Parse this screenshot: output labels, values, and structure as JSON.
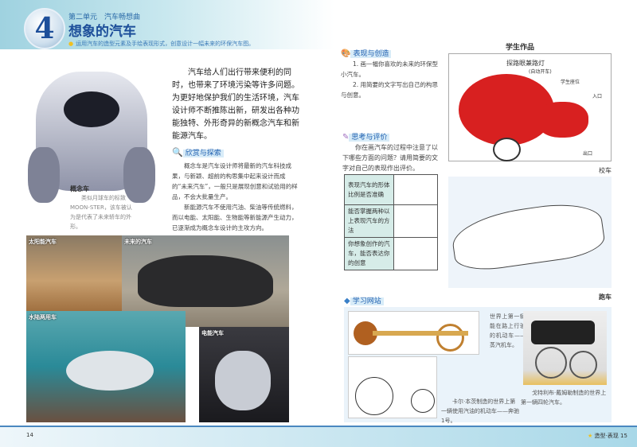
{
  "header": {
    "lesson_number": "4",
    "unit": "第二单元　汽车畅想曲",
    "title": "想象的汽车",
    "goal": "运用汽车的造型元素及手绘表现形式，创意设计一幅未来的环保汽车图。"
  },
  "intro": "汽车给人们出行带来便利的同时，也带来了环境污染等许多问题。为更好地保护我们的生活环境，汽车设计师不断推陈出新，研发出各种功能独特、外形奇异的新概念汽车和新能源汽车。",
  "explore": {
    "heading": "欣赏与探索",
    "p1": "概念车是汽车设计师将最新的汽车科技成果，与新颖、超前的构思集中起来设计而成的“未来汽车”，一般只是展现创意和试验用的样品，不会大批量生产。",
    "p2": "新能源汽车不使用汽油、柴油等传统燃料，而以电能、太阳能、生物能等新能源产生动力，已逐渐成为概念车设计的主攻方向。"
  },
  "concept": {
    "title": "概念车",
    "text": "类似月球车的标致MOON-STER，该车被认为是代表了未来轿车的外形。"
  },
  "photos": [
    "太阳能汽车",
    "未来的汽车",
    "水陆两用车",
    "电能汽车"
  ],
  "create": {
    "heading": "表现与创造",
    "items": [
      "1. 画一幅你喜欢的未来的环保型小汽车。",
      "2. 用简要的文字写出自己的构思与创意。"
    ]
  },
  "evaluate": {
    "heading": "思考与评价",
    "text": "你在画汽车的过程中注意了以下哪些方面的问题？请用简要的文字对自己的表现作出评价。",
    "rows": [
      "表现汽车的形体比例是否准确",
      "能否掌握两种以上表现汽车的方法",
      "你想象创作的汽车，能否表达你的创意"
    ]
  },
  "student": {
    "heading": "学生作品",
    "labels": [
      "探路眼兼路灯",
      "(自动开车)",
      "学生座位",
      "入口",
      "出口"
    ],
    "caption1": "校车",
    "caption2": "跑车"
  },
  "website": {
    "heading": "学习网站",
    "cap1": "世界上第一辆能在路上行驶的机动车——蒸汽机车。",
    "cap2": "卡尔·本茨制造的世界上第一辆使用汽油的机动车——奔驰1号。",
    "cap3": "戈特利布·戴姆勒制造的世界上第一辆四轮汽车。"
  },
  "footer": {
    "left_page": "14",
    "right_section": "造型·表现",
    "right_page": "15"
  }
}
